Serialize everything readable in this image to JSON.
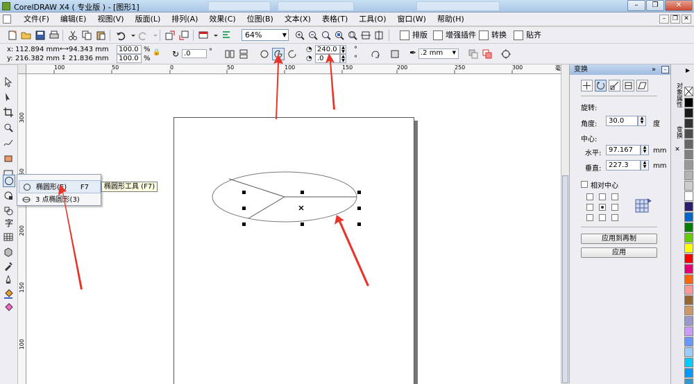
{
  "window": {
    "title": "CorelDRAW X4 ( 专业版 ) - [图形1]"
  },
  "menu": {
    "items": [
      "文件(F)",
      "编辑(E)",
      "视图(V)",
      "版面(L)",
      "排列(A)",
      "效果(C)",
      "位图(B)",
      "文本(X)",
      "表格(T)",
      "工具(O)",
      "窗口(W)",
      "帮助(H)"
    ]
  },
  "toolbar": {
    "zoom": "64%",
    "buttons": [
      "排版",
      "增强插件",
      "转换",
      "贴齐"
    ]
  },
  "propbar": {
    "x_label": "x:",
    "x_value": "112.894 mm",
    "y_label": "y:",
    "y_value": "216.382 mm",
    "w_value": "94.343 mm",
    "h_value": "21.836 mm",
    "scale_x": "100.0",
    "scale_y": "100.0",
    "percent": "%",
    "rotation": ".0",
    "arc_start": "240.0",
    "arc_end": ".0",
    "outline_width": ".2 mm",
    "degree_symbol": "°"
  },
  "ruler": {
    "top_ticks": [
      "100",
      "50",
      "0",
      "50",
      "100",
      "150",
      "200",
      "250",
      "300"
    ],
    "unit": "毫米",
    "left_ticks": [
      "300",
      "250",
      "200",
      "150",
      "100"
    ]
  },
  "flyout": {
    "items": [
      {
        "label": "椭圆形(E)",
        "shortcut": "F7"
      },
      {
        "label": "3 点椭圆形(3)",
        "shortcut": ""
      }
    ],
    "tooltip": "椭圆形工具 (F7)"
  },
  "docker": {
    "title": "变换",
    "section": "旋转:",
    "angle_label": "角度:",
    "angle_value": "30.0",
    "angle_unit": "度",
    "center_label": "中心:",
    "horizontal_label": "水平:",
    "horizontal_value": "97.167",
    "vertical_label": "垂直:",
    "vertical_value": "227.3",
    "unit": "mm",
    "relative_center": "相对中心",
    "apply_dup": "应用到再制",
    "apply": "应用"
  },
  "sidetabs": [
    "对象属性",
    "变换"
  ],
  "palette": [
    "#000000",
    "#1a1a1a",
    "#333333",
    "#4d4d4d",
    "#666666",
    "#808080",
    "#999999",
    "#b3b3b3",
    "#cccccc",
    "#ffffff",
    "#2e1a6e",
    "#0066cc",
    "#008000",
    "#66cc00",
    "#ffff00",
    "#ff0000",
    "#e60073",
    "#ff6600",
    "#ff9999",
    "#996633",
    "#cc9966",
    "#9999cc",
    "#cc99ff",
    "#6699ff",
    "#99ccff",
    "#00ccff",
    "#0099ff",
    "#3399cc"
  ]
}
